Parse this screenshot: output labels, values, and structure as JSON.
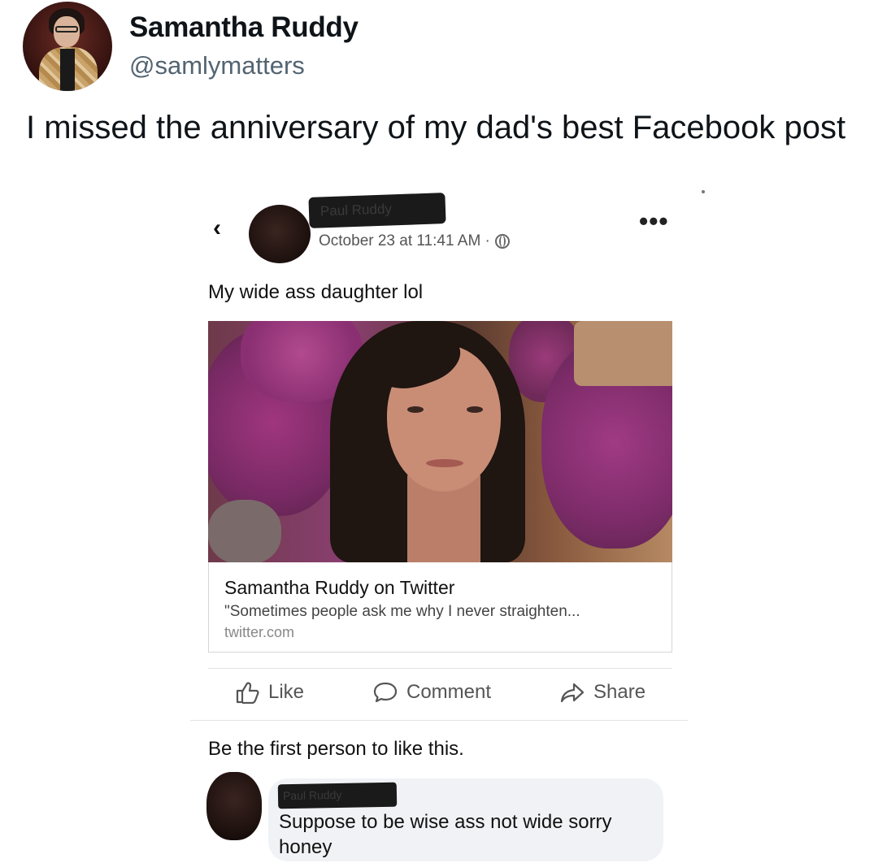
{
  "tweet": {
    "author_name": "Samantha Ruddy",
    "author_handle": "@samlymatters",
    "text": "I missed the anniversary of my dad's best Facebook post"
  },
  "facebook_post": {
    "back_icon": "chevron-left-icon",
    "author_name_redacted": "Paul Ruddy",
    "timestamp": "October 23 at 11:41 AM ·",
    "privacy_icon": "globe-icon",
    "more_label": "•••",
    "caption": "My wide ass daughter lol",
    "link_preview": {
      "title": "Samantha Ruddy on Twitter",
      "description": "\"Sometimes people ask me why I never straighten...",
      "domain": "twitter.com"
    },
    "actions": {
      "like_label": "Like",
      "comment_label": "Comment",
      "share_label": "Share"
    },
    "likes_text": "Be the first person to like this.",
    "comment": {
      "author_name_redacted": "Paul Ruddy",
      "text": "Suppose to be wise ass not wide sorry honey"
    }
  },
  "colors": {
    "text_primary": "#0f1419",
    "text_secondary": "#536471",
    "comment_bubble": "#f0f2f5"
  }
}
